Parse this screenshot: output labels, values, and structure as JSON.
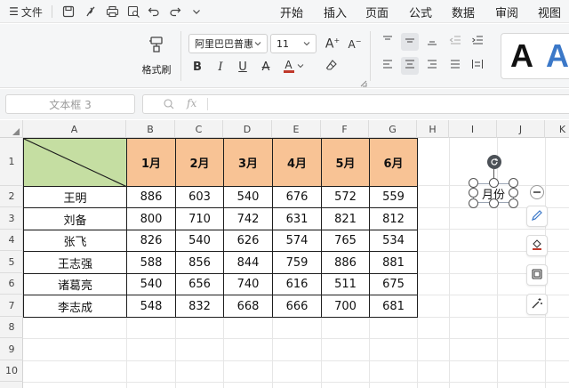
{
  "menubar": {
    "file_label": "文件",
    "tabs": [
      "开始",
      "插入",
      "页面",
      "公式",
      "数据",
      "审阅",
      "视图"
    ]
  },
  "ribbon": {
    "format_painter_label": "格式刷",
    "font_name": "阿里巴巴普惠",
    "font_size": "11",
    "style_preview": [
      "A",
      "A"
    ]
  },
  "formula_bar": {
    "name_box": "文本框 3",
    "fx_label": "fx",
    "content": ""
  },
  "grid": {
    "columns": [
      "A",
      "B",
      "C",
      "D",
      "E",
      "F",
      "G",
      "H",
      "I",
      "J",
      "K"
    ],
    "rows": [
      "1",
      "2",
      "3",
      "4",
      "5",
      "6",
      "7",
      "8",
      "9",
      "10"
    ]
  },
  "table": {
    "months": [
      "1月",
      "2月",
      "3月",
      "4月",
      "5月",
      "6月"
    ],
    "rows": [
      {
        "name": "王明",
        "values": [
          "886",
          "603",
          "540",
          "676",
          "572",
          "559"
        ]
      },
      {
        "name": "刘备",
        "values": [
          "800",
          "710",
          "742",
          "631",
          "821",
          "812"
        ]
      },
      {
        "name": "张飞",
        "values": [
          "826",
          "540",
          "626",
          "574",
          "765",
          "534"
        ]
      },
      {
        "name": "王志强",
        "values": [
          "588",
          "856",
          "844",
          "759",
          "886",
          "881"
        ]
      },
      {
        "name": "诸葛亮",
        "values": [
          "540",
          "656",
          "740",
          "616",
          "511",
          "675"
        ]
      },
      {
        "name": "李志成",
        "values": [
          "548",
          "832",
          "668",
          "666",
          "700",
          "681"
        ]
      }
    ]
  },
  "textbox": {
    "text": "月份"
  },
  "colors": {
    "header_fill": "#f8c395",
    "diagonal_cell_fill": "#c5dea2",
    "style_preview_dark": "#111111",
    "style_preview_blue": "#3b78c8",
    "font_color_bar": "#c0392b"
  }
}
